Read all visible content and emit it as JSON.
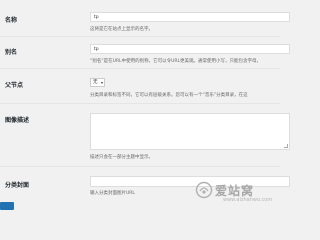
{
  "form": {
    "name": {
      "label": "名称",
      "value": "tp",
      "help": "这将是它在站点上显示的名字。"
    },
    "slug": {
      "label": "别名",
      "value": "tp",
      "help": "“别名”是在URL中使用的别称，它可以令URL更美观。通常使用小写，只能包含字母，"
    },
    "parent": {
      "label": "父节点",
      "value": "无",
      "help": "分类目录和标签不同，它可以有层级关系。您可以有一个“音乐”分类目录，在这"
    },
    "description": {
      "label": "图像描述",
      "value": "",
      "help": "描述只会在一部分主题中显示。"
    },
    "cover": {
      "label": "分类封面",
      "value": "",
      "help": "输入分类封面图片URL"
    }
  },
  "watermark": {
    "text": "爱站窝",
    "url": "www.aizhanwo.com"
  },
  "colors": {
    "background": "#f1f1f1",
    "accent": "#2271b1",
    "watermark": "#a7a7a7"
  }
}
